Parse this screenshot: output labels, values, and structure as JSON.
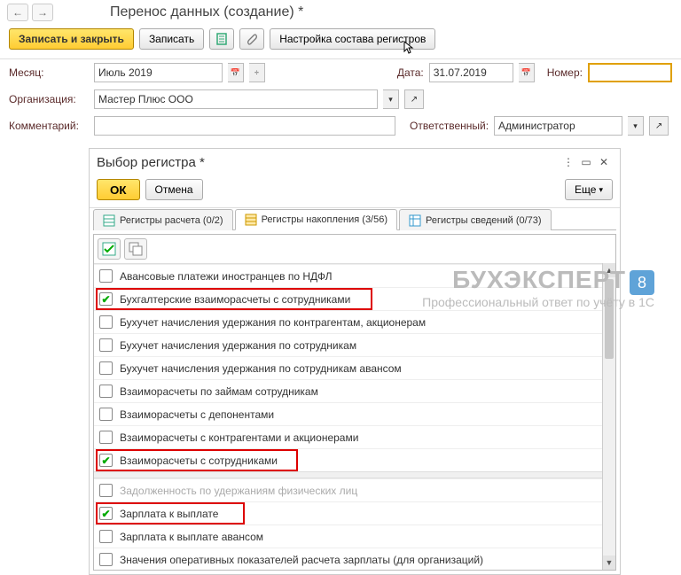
{
  "header": {
    "title": "Перенос данных (создание) *"
  },
  "toolbar": {
    "save_close": "Записать и закрыть",
    "save": "Записать",
    "configure": "Настройка состава регистров"
  },
  "form": {
    "month_label": "Месяц:",
    "month_value": "Июль 2019",
    "date_label": "Дата:",
    "date_value": "31.07.2019",
    "number_label": "Номер:",
    "number_value": "",
    "org_label": "Организация:",
    "org_value": "Мастер Плюс ООО",
    "comment_label": "Комментарий:",
    "comment_value": "",
    "resp_label": "Ответственный:",
    "resp_value": "Администратор"
  },
  "dialog": {
    "title": "Выбор регистра *",
    "ok": "ОК",
    "cancel": "Отмена",
    "more": "Еще",
    "tabs": {
      "calc": "Регистры расчета (0/2)",
      "accum": "Регистры накопления (3/56)",
      "info": "Регистры сведений (0/73)"
    },
    "rows": [
      {
        "label": "Авансовые платежи иностранцев по НДФЛ",
        "checked": false
      },
      {
        "label": "Бухгалтерские взаиморасчеты с сотрудниками",
        "checked": true,
        "highlight": true
      },
      {
        "label": "Бухучет начисления удержания по контрагентам, акционерам",
        "checked": false
      },
      {
        "label": "Бухучет начисления удержания по сотрудникам",
        "checked": false
      },
      {
        "label": "Бухучет начисления удержания по сотрудникам авансом",
        "checked": false
      },
      {
        "label": "Взаиморасчеты по займам сотрудникам",
        "checked": false
      },
      {
        "label": "Взаиморасчеты с депонентами",
        "checked": false
      },
      {
        "label": "Взаиморасчеты с контрагентами и акционерами",
        "checked": false
      },
      {
        "label": "Взаиморасчеты с сотрудниками",
        "checked": true,
        "highlight": true
      },
      {
        "label": "Задолженность по удержаниям физических лиц",
        "checked": false,
        "disabled": true
      },
      {
        "label": "Зарплата к выплате",
        "checked": true,
        "highlight": true
      },
      {
        "label": "Зарплата к выплате авансом",
        "checked": false
      },
      {
        "label": "Значения оперативных показателей расчета зарплаты (для организаций)",
        "checked": false
      }
    ]
  },
  "watermark": {
    "brand": "БУХЭКСПЕРТ",
    "num": "8",
    "motto": "Профессиональный ответ по учёту в 1С"
  }
}
